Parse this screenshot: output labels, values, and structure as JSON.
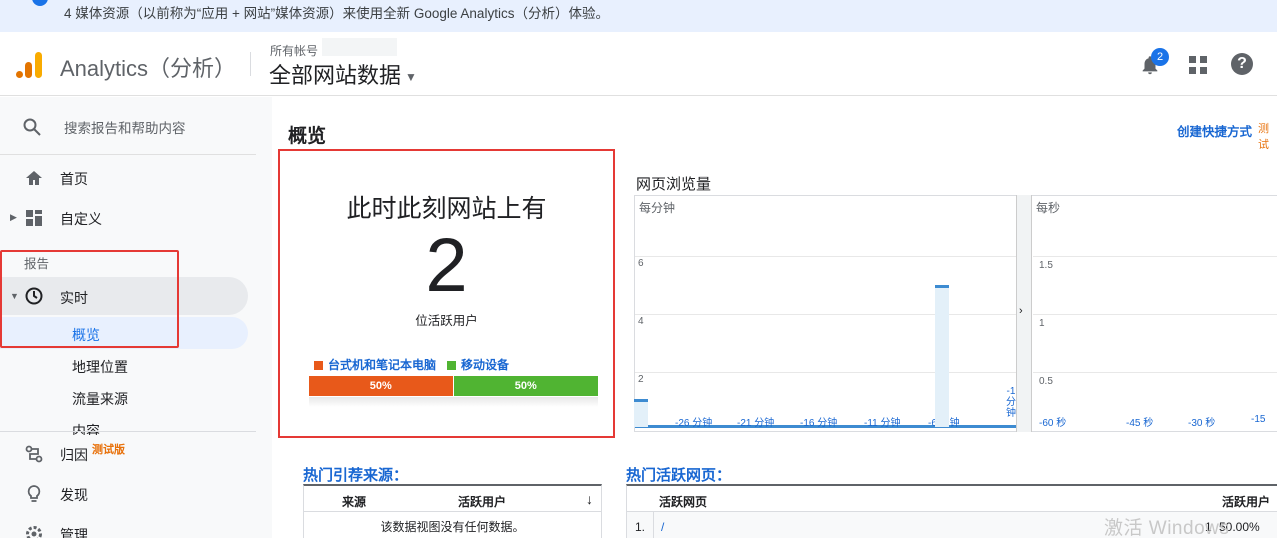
{
  "banner": {
    "text": "4 媒体资源（以前称为“应用 + 网站”媒体资源）来使用全新 Google Analytics（分析）体验。"
  },
  "header": {
    "app_title": "Analytics（分析）",
    "account_label": "所有帐号",
    "property": "全部网站数据",
    "notification_count": "2"
  },
  "sidebar": {
    "search_placeholder": "搜索报告和帮助内容",
    "home": "首页",
    "customize": "自定义",
    "reports_label": "报告",
    "realtime": "实时",
    "sub_items": [
      "概览",
      "地理位置",
      "流量来源",
      "内容"
    ],
    "attribution": "归因",
    "attribution_beta": "测试版",
    "discover": "发现",
    "admin": "管理"
  },
  "main": {
    "title": "概览",
    "shortcut": "创建快捷方式",
    "shortcut_beta": "测试",
    "active_users": {
      "title": "此时此刻网站上有",
      "count": "2",
      "subtitle": "位活跃用户",
      "legend": [
        {
          "label": "台式机和笔记本电脑",
          "color": "#e8591a"
        },
        {
          "label": "移动设备",
          "color": "#50b432"
        }
      ],
      "split": [
        {
          "label": "50%",
          "value": 50,
          "color": "#e8591a"
        },
        {
          "label": "50%",
          "value": 50,
          "color": "#50b432"
        }
      ]
    },
    "pageviews": {
      "title": "网页浏览量",
      "per_minute_label": "每分钟",
      "per_second_label": "每秒",
      "minute_yticks": [
        "6",
        "4",
        "2"
      ],
      "minute_xticks": [
        "-26 分钟",
        "-21 分钟",
        "-16 分钟",
        "-11 分钟",
        "-6 分钟"
      ],
      "last_tick": [
        "-1",
        "分",
        "钟"
      ],
      "second_yticks": [
        "1.5",
        "1",
        "0.5"
      ],
      "second_xticks": [
        "-60 秒",
        "-45 秒",
        "-30 秒",
        "-15"
      ]
    },
    "top_referrals": {
      "title": "热门引荐来源：",
      "col_source": "来源",
      "col_users": "活跃用户",
      "sort_icon": "↓",
      "empty": "该数据视图没有任何数据。"
    },
    "top_pages": {
      "title": "热门活跃网页：",
      "col_page": "活跃网页",
      "col_users": "活跃用户",
      "rows": [
        {
          "rank": "1.",
          "page": "/",
          "users": "1",
          "pct": "50.00%"
        }
      ]
    }
  },
  "watermark": "激活 Windows",
  "chart_data": {
    "type": "bar",
    "title": "网页浏览量",
    "series": [
      {
        "name": "每分钟",
        "x": [
          -30,
          -6
        ],
        "values": [
          1,
          5
        ]
      }
    ],
    "ylim": [
      0,
      8
    ],
    "xlabel": "",
    "ylabel": ""
  }
}
